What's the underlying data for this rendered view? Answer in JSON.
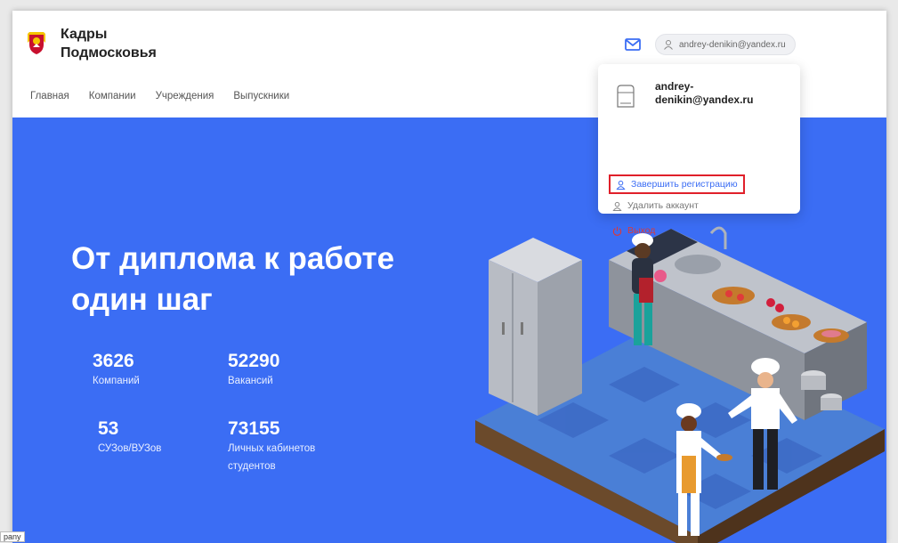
{
  "brand": {
    "line1": "Кадры",
    "line2": "Подмосковья"
  },
  "nav": [
    "Главная",
    "Компании",
    "Учреждения",
    "Выпускники"
  ],
  "user": {
    "email_chip": "andrey-denikin@yandex.ru"
  },
  "dropdown": {
    "email_line1": "andrey-",
    "email_line2": "denikin@yandex.ru",
    "complete_registration": "Завершить регистрацию",
    "delete_account": "Удалить аккаунт",
    "logout": "Выход"
  },
  "hero": {
    "title_line1": "От диплома к работе",
    "title_line2": "один шаг",
    "stats": [
      {
        "value": "3626",
        "label": "Компаний"
      },
      {
        "value": "52290",
        "label": "Вакансий"
      },
      {
        "value": "53",
        "label": "СУЗов/ВУЗов"
      },
      {
        "value": "73155",
        "label": "Личных кабинетов студентов"
      }
    ]
  },
  "corner_tag": "pany",
  "colors": {
    "hero_bg": "#3b6df4",
    "accent": "#3b6df4",
    "danger": "#d93a3a",
    "highlight": "#e0202a"
  },
  "icons": [
    "coat-of-arms-logo",
    "mail-icon",
    "user-icon",
    "document-avatar-icon",
    "user-add-icon",
    "user-remove-icon",
    "power-icon"
  ]
}
